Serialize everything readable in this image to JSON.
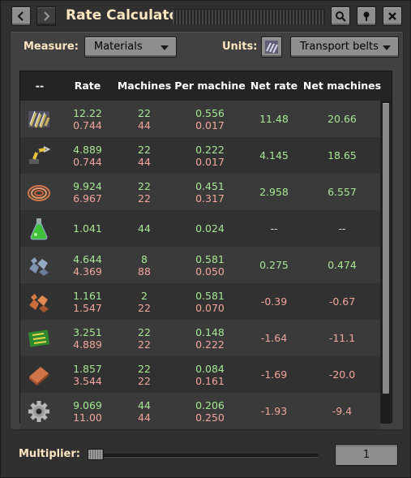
{
  "window": {
    "title": "Rate Calculator"
  },
  "controls": {
    "measure_label": "Measure:",
    "measure_value": "Materials",
    "units_label": "Units:",
    "units_value": "Transport belts"
  },
  "table": {
    "headers": [
      "--",
      "Rate",
      "Machines",
      "Per machine",
      "Net rate",
      "Net machines"
    ],
    "rows": [
      {
        "icon": "belt-icon",
        "rate": [
          "12.22",
          "0.744"
        ],
        "machines": [
          "22",
          "44"
        ],
        "per_machine": [
          "0.556",
          "0.017"
        ],
        "net_rate": "11.48",
        "net_machines": "20.66",
        "net_tone": "g"
      },
      {
        "icon": "inserter-icon",
        "rate": [
          "4.889",
          "0.744"
        ],
        "machines": [
          "22",
          "44"
        ],
        "per_machine": [
          "0.222",
          "0.017"
        ],
        "net_rate": "4.145",
        "net_machines": "18.65",
        "net_tone": "g"
      },
      {
        "icon": "copper-cable-icon",
        "rate": [
          "9.924",
          "6.967"
        ],
        "machines": [
          "22",
          "22"
        ],
        "per_machine": [
          "0.451",
          "0.317"
        ],
        "net_rate": "2.958",
        "net_machines": "6.557",
        "net_tone": "g"
      },
      {
        "icon": "science-pack-icon",
        "rate": [
          "1.041"
        ],
        "machines": [
          "44"
        ],
        "per_machine": [
          "0.024"
        ],
        "net_rate": "--",
        "net_machines": "--",
        "net_tone": "w"
      },
      {
        "icon": "iron-ore-icon",
        "rate": [
          "4.644",
          "4.369"
        ],
        "machines": [
          "8",
          "88"
        ],
        "per_machine": [
          "0.581",
          "0.050"
        ],
        "net_rate": "0.275",
        "net_machines": "0.474",
        "net_tone": "g"
      },
      {
        "icon": "copper-ore-icon",
        "rate": [
          "1.161",
          "1.547"
        ],
        "machines": [
          "2",
          "22"
        ],
        "per_machine": [
          "0.581",
          "0.070"
        ],
        "net_rate": "-0.39",
        "net_machines": "-0.67",
        "net_tone": "r"
      },
      {
        "icon": "electronic-circuit-icon",
        "rate": [
          "3.251",
          "4.889"
        ],
        "machines": [
          "22",
          "22"
        ],
        "per_machine": [
          "0.148",
          "0.222"
        ],
        "net_rate": "-1.64",
        "net_machines": "-11.1",
        "net_tone": "r"
      },
      {
        "icon": "copper-plate-icon",
        "rate": [
          "1.857",
          "3.544"
        ],
        "machines": [
          "22",
          "22"
        ],
        "per_machine": [
          "0.084",
          "0.161"
        ],
        "net_rate": "-1.69",
        "net_machines": "-20.0",
        "net_tone": "r"
      },
      {
        "icon": "gear-icon",
        "rate": [
          "9.069",
          "11.00"
        ],
        "machines": [
          "44",
          "44"
        ],
        "per_machine": [
          "0.206",
          "0.250"
        ],
        "net_rate": "-1.93",
        "net_machines": "-9.4",
        "net_tone": "r"
      }
    ]
  },
  "footer": {
    "multiplier_label": "Multiplier:",
    "multiplier_value": "1",
    "multiplier_slider_value": 1
  },
  "colors": {
    "positive": "#a6e793",
    "negative": "#f2a69b",
    "title": "#ffe6c0"
  }
}
